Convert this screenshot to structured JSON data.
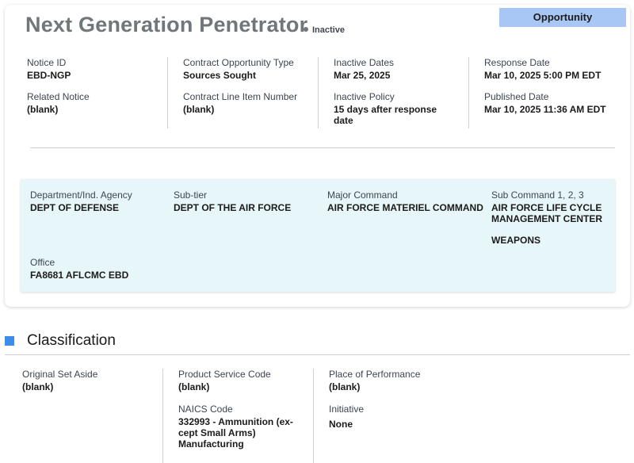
{
  "opportunity_tag": "Opportunity",
  "title": "Next Generation Penetrator",
  "status": "Inactive",
  "overview": {
    "notice_id": {
      "label": "Notice ID",
      "value": "EBD-NGP"
    },
    "related_notice": {
      "label": "Related Notice",
      "value": "(blank)"
    },
    "contract_type": {
      "label": "Contract Opportunity Type",
      "value": "Sources Sought"
    },
    "clin": {
      "label": "Contract Line Item Number",
      "value": "(blank)"
    },
    "inactive_dates": {
      "label": "Inactive Dates",
      "value": "Mar 25, 2025"
    },
    "inactive_policy": {
      "label": "Inactive Policy",
      "value_line1": "15 days after response",
      "value_line2": "date"
    },
    "response_date": {
      "label": "Response Date",
      "value": "Mar 10, 2025 5:00 PM EDT"
    },
    "published_date": {
      "label": "Published Date",
      "value": "Mar 10, 2025 11:36 AM EDT"
    }
  },
  "agency": {
    "department": {
      "label": "Department/Ind. Agency",
      "value": "DEPT OF DEFENSE"
    },
    "subtier": {
      "label": "Sub-tier",
      "value": "DEPT OF THE AIR FORCE"
    },
    "major_command": {
      "label": "Major Command",
      "value": "AIR FORCE MATERIEL COMMAND"
    },
    "sub_command": {
      "label": "Sub Command 1, 2, 3",
      "value_line1": "AIR FORCE LIFE CYCLE",
      "value_line2": "MANAGEMENT CENTER",
      "value_line3": "WEAPONS"
    },
    "office": {
      "label": "Office",
      "value": "FA8681 AFLCMC EBD"
    }
  },
  "classification": {
    "heading": "Classification",
    "set_aside": {
      "label": "Original Set Aside",
      "value": "(blank)"
    },
    "psc": {
      "label": "Product Service Code",
      "value": "(blank)"
    },
    "naics": {
      "label": "NAICS Code",
      "value_line1": "332993 - Ammunition (ex-",
      "value_line2": "cept Small Arms)",
      "value_line3": "Manufacturing"
    },
    "place": {
      "label": "Place of Performance",
      "value": "(blank)"
    },
    "initiative": {
      "label": "Initiative",
      "value": "None"
    }
  },
  "colors": {
    "accent": "#3f8ce8",
    "tag_bg": "#a9c7f5",
    "agency_bg": "#e7f6f8",
    "title": "#71767a"
  }
}
